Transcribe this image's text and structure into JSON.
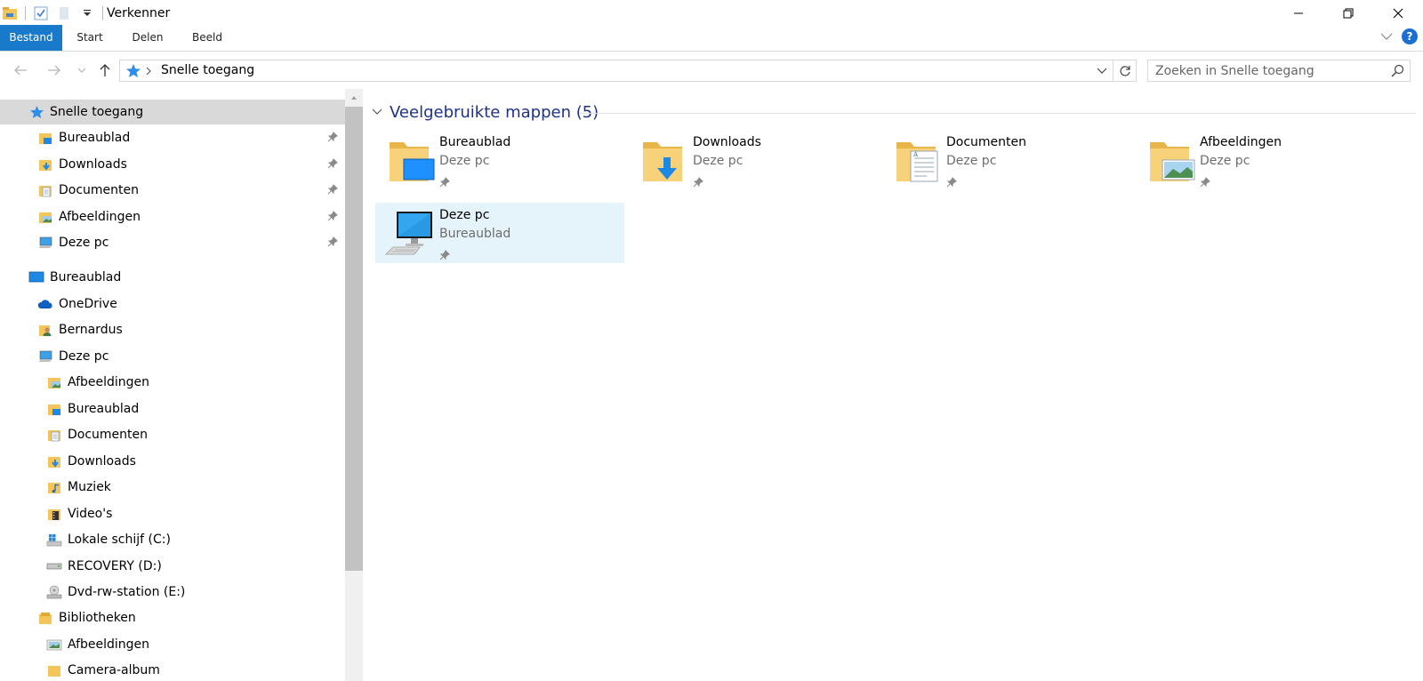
{
  "window": {
    "title": "Verkenner"
  },
  "ribbon": {
    "tabs": [
      {
        "label": "Bestand"
      },
      {
        "label": "Start"
      },
      {
        "label": "Delen"
      },
      {
        "label": "Beeld"
      }
    ],
    "help_label": "?"
  },
  "address": {
    "current": "Snelle toegang",
    "search_placeholder": "Zoeken in Snelle toegang"
  },
  "nav": {
    "quick_access": {
      "label": "Snelle toegang"
    },
    "pinned": [
      {
        "label": "Bureaublad",
        "icon": "desktop-folder-icon"
      },
      {
        "label": "Downloads",
        "icon": "downloads-folder-icon"
      },
      {
        "label": "Documenten",
        "icon": "documents-folder-icon"
      },
      {
        "label": "Afbeeldingen",
        "icon": "pictures-folder-icon"
      },
      {
        "label": "Deze pc",
        "icon": "computer-icon"
      }
    ],
    "tree": [
      {
        "label": "Bureaublad",
        "icon": "desktop-icon",
        "level": 0
      },
      {
        "label": "OneDrive",
        "icon": "onedrive-icon",
        "level": 1
      },
      {
        "label": "Bernardus",
        "icon": "user-folder-icon",
        "level": 1
      },
      {
        "label": "Deze pc",
        "icon": "computer-icon",
        "level": 1
      },
      {
        "label": "Afbeeldingen",
        "icon": "pictures-folder-icon",
        "level": 2
      },
      {
        "label": "Bureaublad",
        "icon": "desktop-folder-icon",
        "level": 2
      },
      {
        "label": "Documenten",
        "icon": "documents-folder-icon",
        "level": 2
      },
      {
        "label": "Downloads",
        "icon": "downloads-folder-icon",
        "level": 2
      },
      {
        "label": "Muziek",
        "icon": "music-folder-icon",
        "level": 2
      },
      {
        "label": "Video's",
        "icon": "videos-folder-icon",
        "level": 2
      },
      {
        "label": "Lokale schijf (C:)",
        "icon": "windows-drive-icon",
        "level": 2
      },
      {
        "label": "RECOVERY (D:)",
        "icon": "drive-icon",
        "level": 2
      },
      {
        "label": "Dvd-rw-station (E:)",
        "icon": "dvd-drive-icon",
        "level": 2
      },
      {
        "label": "Bibliotheken",
        "icon": "libraries-icon",
        "level": 1
      },
      {
        "label": "Afbeeldingen",
        "icon": "pictures-library-icon",
        "level": 2
      },
      {
        "label": "Camera-album",
        "icon": "folder-icon",
        "level": 2
      }
    ]
  },
  "content": {
    "group_title": "Veelgebruikte mappen (5)",
    "tiles": [
      {
        "name": "Bureaublad",
        "sub": "Deze pc",
        "icon": "desktop-folder-icon"
      },
      {
        "name": "Downloads",
        "sub": "Deze pc",
        "icon": "downloads-folder-icon"
      },
      {
        "name": "Documenten",
        "sub": "Deze pc",
        "icon": "documents-folder-icon"
      },
      {
        "name": "Afbeeldingen",
        "sub": "Deze pc",
        "icon": "pictures-folder-icon"
      },
      {
        "name": "Deze pc",
        "sub": "Bureaublad",
        "icon": "computer-icon",
        "selected": true
      }
    ]
  },
  "colors": {
    "file_tab": "#1979ca",
    "group_title": "#1e3287",
    "folder": "#f4c55a",
    "selection": "#e5f3fb"
  }
}
